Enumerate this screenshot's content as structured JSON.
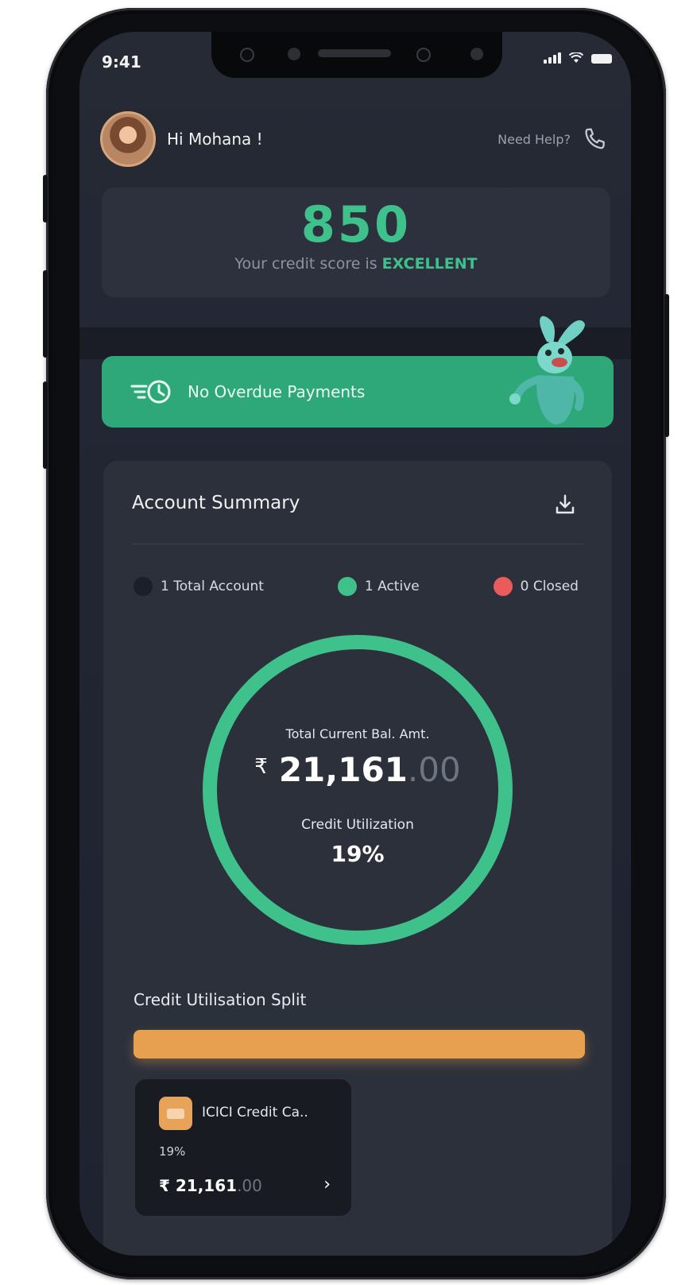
{
  "status_bar": {
    "time": "9:41"
  },
  "header": {
    "greeting": "Hi Mohana !",
    "help_label": "Need Help?"
  },
  "credit_score": {
    "value": "850",
    "caption_prefix": "Your credit score is",
    "rating": "EXCELLENT"
  },
  "overdue_banner": {
    "label": "No Overdue Payments"
  },
  "account_summary": {
    "title": "Account Summary",
    "legend": [
      {
        "label": "1 Total Account",
        "color": "#1c1f27"
      },
      {
        "label": "1 Active",
        "color": "#3fc18b"
      },
      {
        "label": "0 Closed",
        "color": "#ea5c5c"
      }
    ],
    "ring": {
      "label": "Total Current Bal. Amt.",
      "currency": "₹",
      "amount_whole": "21,161",
      "amount_decimal": ".00",
      "utilization_label": "Credit Utilization",
      "utilization_value": "19%"
    },
    "split": {
      "title": "Credit Utilisation Split",
      "cards": [
        {
          "name": "ICICI Credit Ca..",
          "percent": "19%",
          "amount_whole": "₹ 21,161",
          "amount_decimal": ".00"
        }
      ]
    }
  },
  "colors": {
    "accent_green": "#3fc18b",
    "banner_green": "#2ea878",
    "split_orange": "#e79f50",
    "background": "#232733"
  }
}
